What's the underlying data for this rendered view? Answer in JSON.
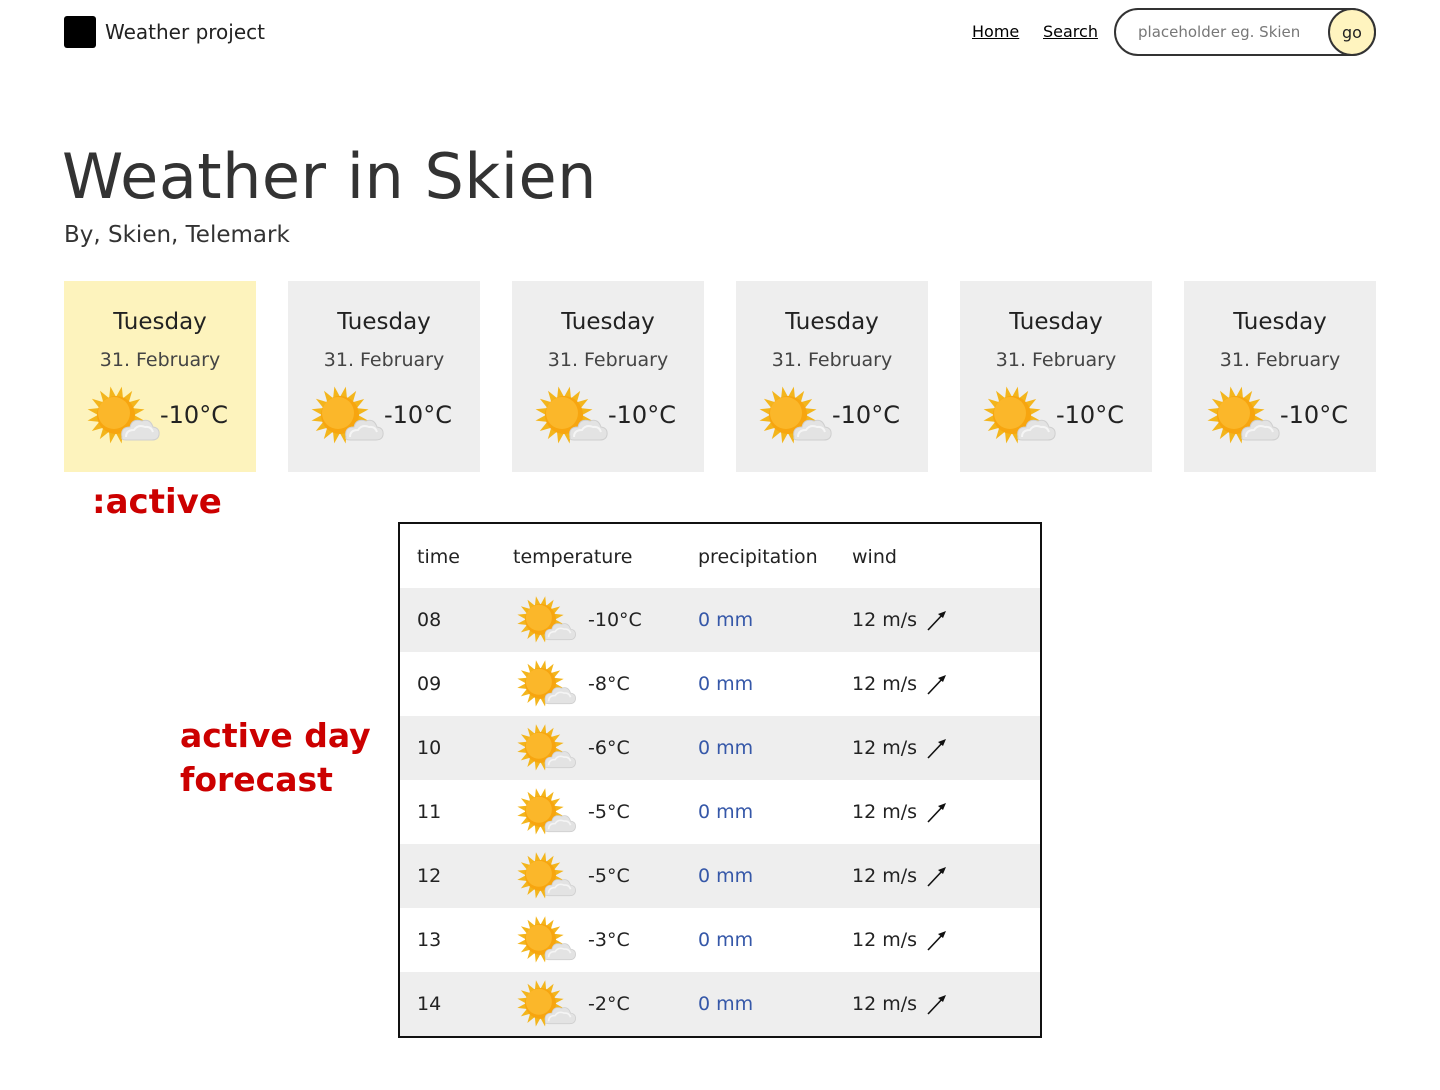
{
  "header": {
    "brand": "Weather project",
    "nav": {
      "home": "Home",
      "search": "Search"
    },
    "search": {
      "placeholder": "placeholder eg. Skien",
      "value": "",
      "button": "go"
    }
  },
  "page": {
    "title": "Weather in Skien",
    "subtitle": "By, Skien, Telemark"
  },
  "days": [
    {
      "name": "Tuesday",
      "date": "31. February",
      "temp": "-10°C",
      "icon": "sun-behind-cloud-icon",
      "active": true
    },
    {
      "name": "Tuesday",
      "date": "31. February",
      "temp": "-10°C",
      "icon": "sun-behind-cloud-icon",
      "active": false
    },
    {
      "name": "Tuesday",
      "date": "31. February",
      "temp": "-10°C",
      "icon": "sun-behind-cloud-icon",
      "active": false
    },
    {
      "name": "Tuesday",
      "date": "31. February",
      "temp": "-10°C",
      "icon": "sun-behind-cloud-icon",
      "active": false
    },
    {
      "name": "Tuesday",
      "date": "31. February",
      "temp": "-10°C",
      "icon": "sun-behind-cloud-icon",
      "active": false
    },
    {
      "name": "Tuesday",
      "date": "31. February",
      "temp": "-10°C",
      "icon": "sun-behind-cloud-icon",
      "active": false
    }
  ],
  "annotations": {
    "active": ":active",
    "forecast_line1": "active day",
    "forecast_line2": "forecast"
  },
  "forecast": {
    "headers": {
      "time": "time",
      "temperature": "temperature",
      "precipitation": "precipitation",
      "wind": "wind"
    },
    "rows": [
      {
        "time": "08",
        "temp": "-10°C",
        "precip": "0 mm",
        "wind": "12 m/s",
        "icon": "sun-behind-cloud-icon",
        "wind_icon": "wind-direction-arrow-icon"
      },
      {
        "time": "09",
        "temp": "-8°C",
        "precip": "0 mm",
        "wind": "12 m/s",
        "icon": "sun-behind-cloud-icon",
        "wind_icon": "wind-direction-arrow-icon"
      },
      {
        "time": "10",
        "temp": "-6°C",
        "precip": "0 mm",
        "wind": "12 m/s",
        "icon": "sun-behind-cloud-icon",
        "wind_icon": "wind-direction-arrow-icon"
      },
      {
        "time": "11",
        "temp": "-5°C",
        "precip": "0 mm",
        "wind": "12 m/s",
        "icon": "sun-behind-cloud-icon",
        "wind_icon": "wind-direction-arrow-icon"
      },
      {
        "time": "12",
        "temp": "-5°C",
        "precip": "0 mm",
        "wind": "12 m/s",
        "icon": "sun-behind-cloud-icon",
        "wind_icon": "wind-direction-arrow-icon"
      },
      {
        "time": "13",
        "temp": "-3°C",
        "precip": "0 mm",
        "wind": "12 m/s",
        "icon": "sun-behind-cloud-icon",
        "wind_icon": "wind-direction-arrow-icon"
      },
      {
        "time": "14",
        "temp": "-2°C",
        "precip": "0 mm",
        "wind": "12 m/s",
        "icon": "sun-behind-cloud-icon",
        "wind_icon": "wind-direction-arrow-icon"
      }
    ]
  },
  "colors": {
    "active_card": "#fdf3bd",
    "card": "#eeeeee",
    "annotation": "#cc0000",
    "precipitation": "#3557a8",
    "go_button": "#fff4bf"
  }
}
